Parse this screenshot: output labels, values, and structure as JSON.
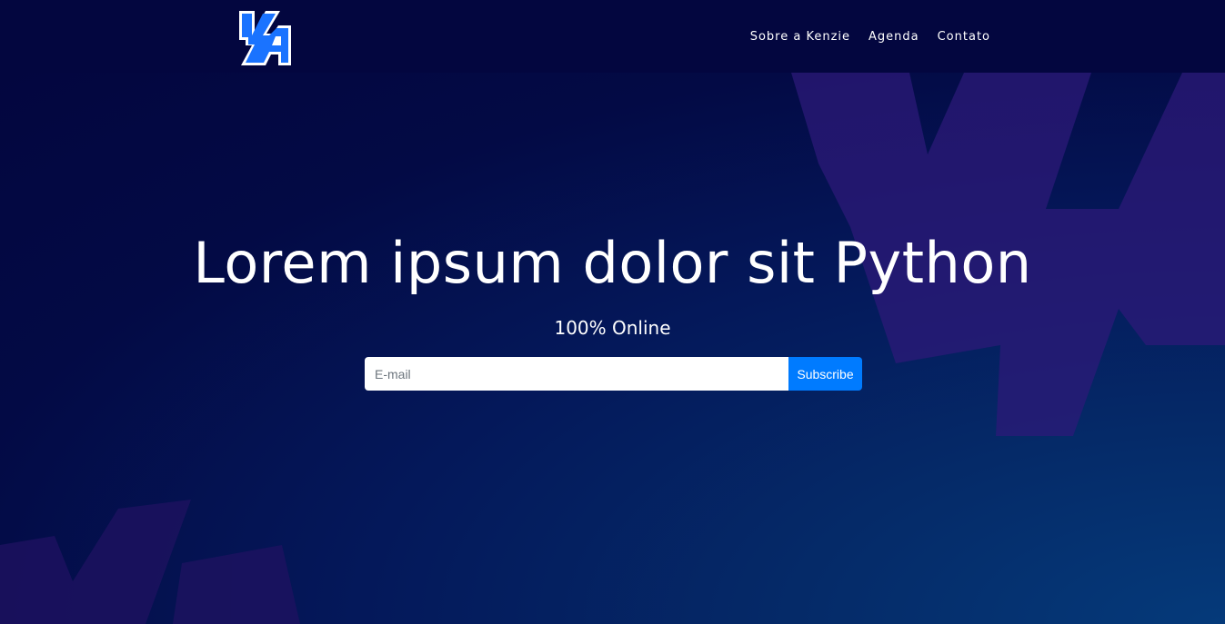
{
  "header": {
    "logo_alt": "Kenzie Academy",
    "nav": [
      {
        "label": "Sobre a Kenzie"
      },
      {
        "label": "Agenda"
      },
      {
        "label": "Contato"
      }
    ]
  },
  "hero": {
    "title": "Lorem ipsum dolor sit Python",
    "subtitle": "100% Online",
    "email_placeholder": "E-mail",
    "subscribe_label": "Subscribe"
  },
  "colors": {
    "header_bg": "#03063f",
    "accent": "#007bff",
    "logo_blue": "#1a73ff"
  }
}
